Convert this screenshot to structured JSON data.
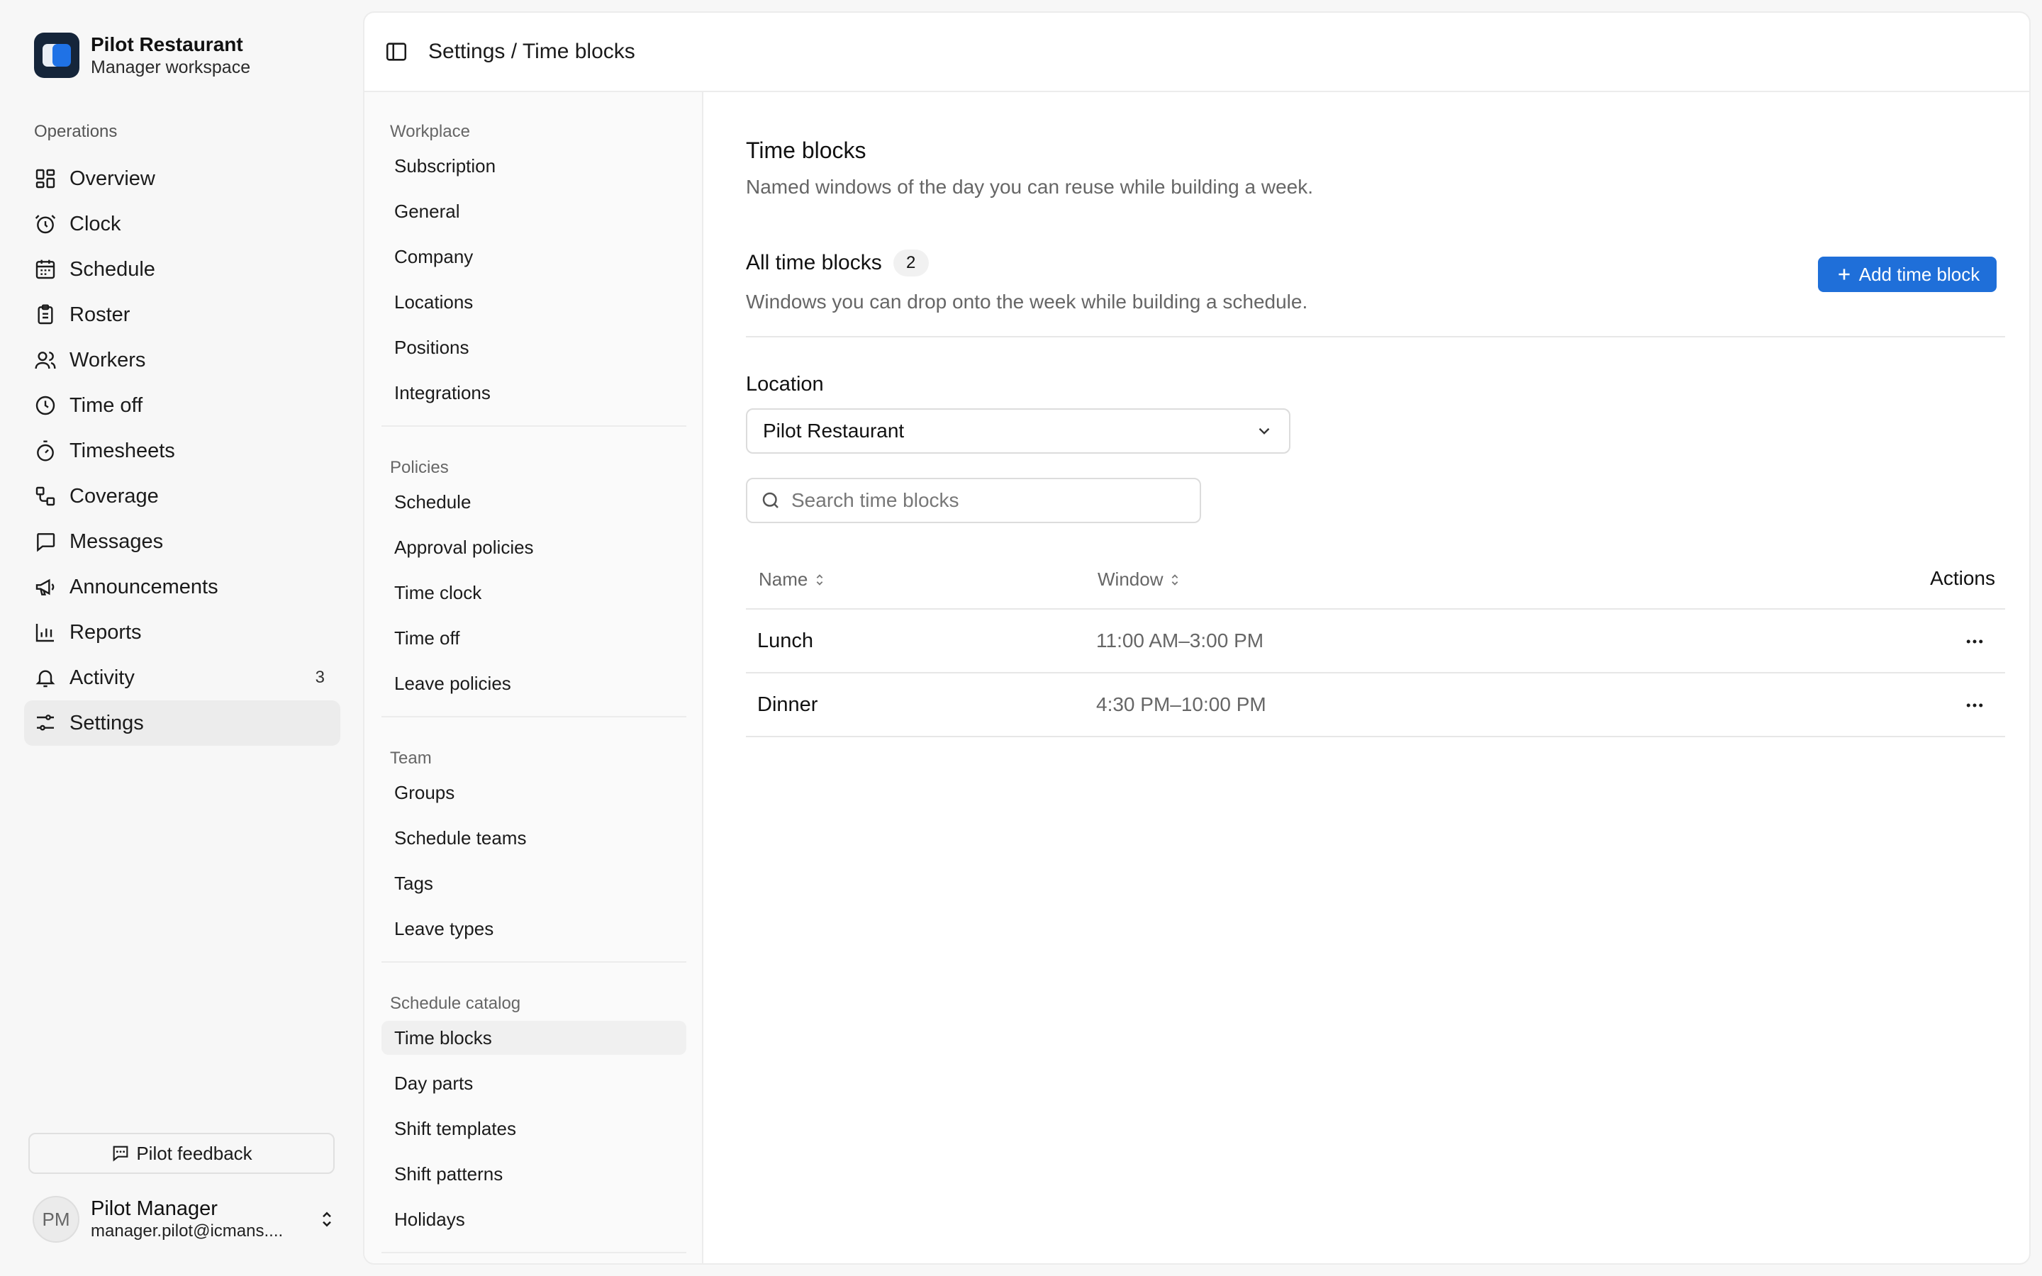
{
  "workspace": {
    "name": "Pilot Restaurant",
    "subtitle": "Manager workspace"
  },
  "sidebar": {
    "section_title": "Operations",
    "items": [
      {
        "label": "Overview",
        "icon": "grid-icon"
      },
      {
        "label": "Clock",
        "icon": "alarm-clock-icon"
      },
      {
        "label": "Schedule",
        "icon": "calendar-icon"
      },
      {
        "label": "Roster",
        "icon": "clipboard-icon"
      },
      {
        "label": "Workers",
        "icon": "users-icon"
      },
      {
        "label": "Time off",
        "icon": "clock-icon"
      },
      {
        "label": "Timesheets",
        "icon": "stopwatch-icon"
      },
      {
        "label": "Coverage",
        "icon": "coverage-icon"
      },
      {
        "label": "Messages",
        "icon": "message-icon"
      },
      {
        "label": "Announcements",
        "icon": "megaphone-icon"
      },
      {
        "label": "Reports",
        "icon": "bar-chart-icon"
      },
      {
        "label": "Activity",
        "icon": "bell-icon",
        "badge": "3"
      },
      {
        "label": "Settings",
        "icon": "sliders-icon",
        "active": true
      }
    ],
    "feedback_label": "Pilot feedback",
    "user": {
      "initials": "PM",
      "name": "Pilot Manager",
      "email": "manager.pilot@icmans...."
    }
  },
  "topbar": {
    "breadcrumb": "Settings / Time blocks"
  },
  "settings_nav": {
    "groups": [
      {
        "title": "Workplace",
        "items": [
          "Subscription",
          "General",
          "Company",
          "Locations",
          "Positions",
          "Integrations"
        ]
      },
      {
        "title": "Policies",
        "items": [
          "Schedule",
          "Approval policies",
          "Time clock",
          "Time off",
          "Leave policies"
        ]
      },
      {
        "title": "Team",
        "items": [
          "Groups",
          "Schedule teams",
          "Tags",
          "Leave types"
        ]
      },
      {
        "title": "Schedule catalog",
        "items": [
          "Time blocks",
          "Day parts",
          "Shift templates",
          "Shift patterns",
          "Holidays"
        ]
      }
    ],
    "active_item": "Time blocks"
  },
  "page": {
    "title": "Time blocks",
    "subtitle": "Named windows of the day you can reuse while building a week.",
    "section_title": "All time blocks",
    "count": "2",
    "section_subtitle": "Windows you can drop onto the week while building a schedule.",
    "add_button": "Add time block",
    "location_label": "Location",
    "location_value": "Pilot Restaurant",
    "search_placeholder": "Search time blocks"
  },
  "table": {
    "columns": {
      "name": "Name",
      "window": "Window",
      "actions": "Actions"
    },
    "rows": [
      {
        "name": "Lunch",
        "window": "11:00 AM–3:00 PM"
      },
      {
        "name": "Dinner",
        "window": "4:30 PM–10:00 PM"
      }
    ]
  },
  "colors": {
    "accent": "#1f6fd9",
    "brand_dark": "#15253a"
  }
}
